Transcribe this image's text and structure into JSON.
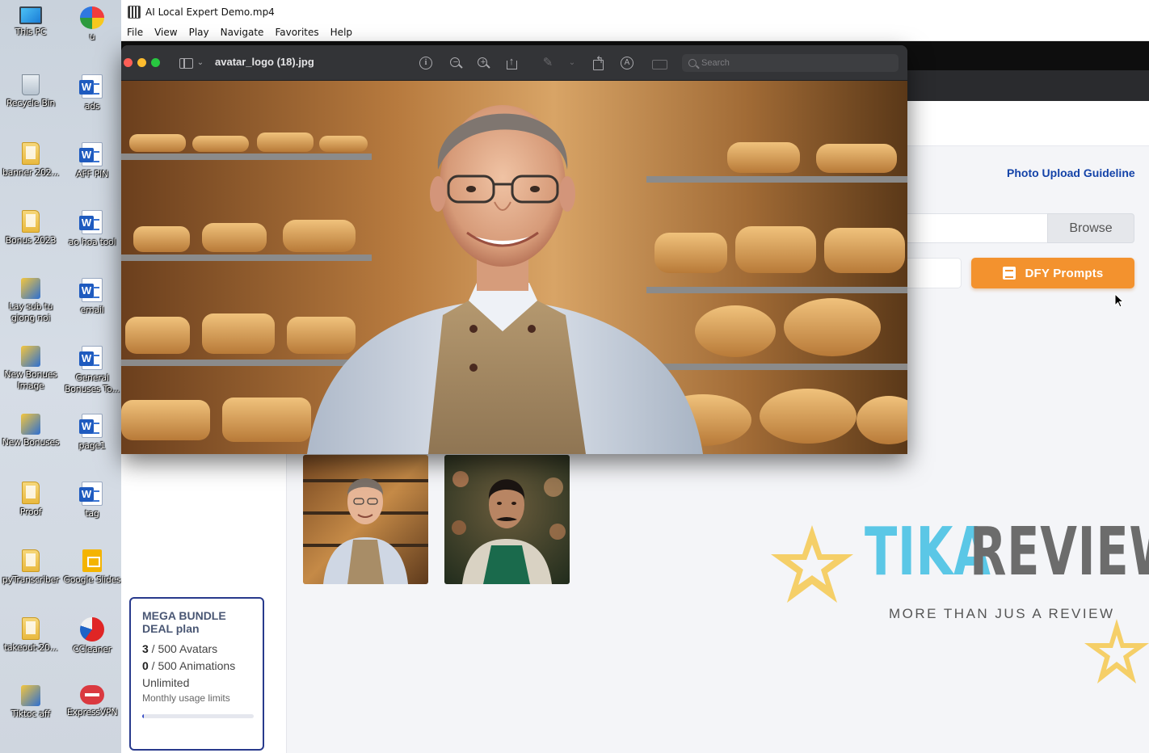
{
  "desktop": {
    "icons": [
      {
        "label": "This PC",
        "icon": "this-pc-icon"
      },
      {
        "label": "u",
        "icon": "app-icon"
      },
      {
        "label": "Recycle Bin",
        "icon": "recycle-bin-icon"
      },
      {
        "label": "ads",
        "icon": "word-doc-icon"
      },
      {
        "label": "banner 202...",
        "icon": "folder-icon"
      },
      {
        "label": "AFF PIN",
        "icon": "word-doc-icon"
      },
      {
        "label": "Bonus 2023",
        "icon": "folder-icon"
      },
      {
        "label": "ao hoa tool",
        "icon": "word-doc-icon"
      },
      {
        "label": "Lay sub tu giong noi",
        "icon": "app-icon"
      },
      {
        "label": "email",
        "icon": "word-doc-icon"
      },
      {
        "label": "New Bonues Image",
        "icon": "app-icon"
      },
      {
        "label": "General Bonuses To...",
        "icon": "word-doc-icon"
      },
      {
        "label": "New Bonuses",
        "icon": "app-icon"
      },
      {
        "label": "page1",
        "icon": "word-doc-icon"
      },
      {
        "label": "Proof",
        "icon": "folder-icon"
      },
      {
        "label": "tag",
        "icon": "word-doc-icon"
      },
      {
        "label": "pyTranscriber",
        "icon": "folder-icon"
      },
      {
        "label": "Google Slides",
        "icon": "google-slides-icon"
      },
      {
        "label": "takeout-20...",
        "icon": "folder-icon"
      },
      {
        "label": "CCleaner",
        "icon": "ccleaner-icon"
      },
      {
        "label": "Tiktoc aff",
        "icon": "app-icon"
      },
      {
        "label": "ExpressVPN",
        "icon": "expressvpn-icon"
      }
    ]
  },
  "player": {
    "title": "AI Local Expert Demo.mp4",
    "menu": [
      "File",
      "View",
      "Play",
      "Navigate",
      "Favorites",
      "Help"
    ]
  },
  "video_page": {
    "guideline_link": "Photo Upload Guideline",
    "browse_label": "Browse",
    "dfy_label": "DFY Prompts",
    "plan": {
      "title": "MEGA BUNDLE DEAL plan",
      "avatars_used": "3",
      "avatars_text": " / 500 Avatars",
      "animations_used": "0",
      "animations_text": " / 500 Animations",
      "unlimited": "Unlimited",
      "note": "Monthly usage limits",
      "progress": 0.006
    }
  },
  "watermark": {
    "word1": "TIKA",
    "word2": "REVIEW",
    "tagline": "MORE THAN JUS A REVIEW",
    "colors": {
      "accent": "#5bc7e6",
      "gray": "#6c6c6c",
      "star": "#f5cf68"
    }
  },
  "viewer": {
    "filename": "avatar_logo (18).jpg",
    "search_placeholder": "Search",
    "toolbar_icons": [
      "sidebar-toggle-icon",
      "info-icon",
      "zoom-out-icon",
      "zoom-in-icon",
      "share-icon",
      "markup-pen-icon",
      "rotate-icon",
      "annotate-icon",
      "sign-icon"
    ]
  },
  "colors": {
    "dfy_orange": "#f3922e",
    "link_blue": "#1443a8",
    "plan_border": "#283a8c"
  }
}
